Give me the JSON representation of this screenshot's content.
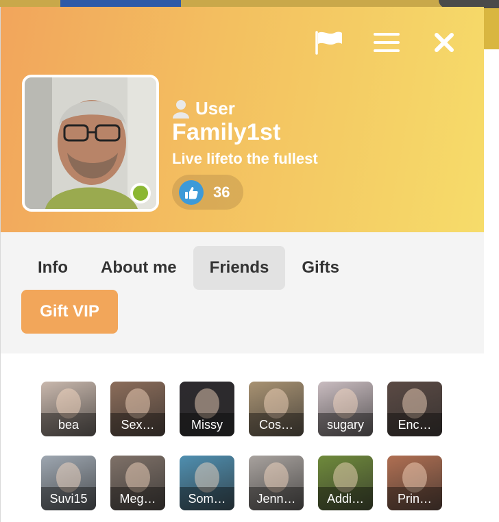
{
  "header": {
    "role": "User",
    "username": "Family1st",
    "tagline": "Live lifeto the fullest",
    "likes": "36",
    "icons": [
      "flag-icon",
      "menu-icon",
      "close-icon"
    ],
    "online": true
  },
  "tabs": [
    {
      "label": "Info",
      "active": false
    },
    {
      "label": "About me",
      "active": false
    },
    {
      "label": "Friends",
      "active": true
    },
    {
      "label": "Gifts",
      "active": false
    }
  ],
  "gift_vip_label": "Gift VIP",
  "friends": [
    {
      "name": "bea",
      "color": "#c9b8ad"
    },
    {
      "name": "Sex…",
      "color": "#8c6d5a"
    },
    {
      "name": "Missy",
      "color": "#2d2a2e"
    },
    {
      "name": "Cos…",
      "color": "#a89272"
    },
    {
      "name": "sugary",
      "color": "#c9bcc0"
    },
    {
      "name": "Enc…",
      "color": "#5b4a44"
    },
    {
      "name": "Suvi15",
      "color": "#9ea7b1"
    },
    {
      "name": "Meg…",
      "color": "#7f7168"
    },
    {
      "name": "Som…",
      "color": "#4f8fb0"
    },
    {
      "name": "Jenn…",
      "color": "#a8a29e"
    },
    {
      "name": "Addi…",
      "color": "#6f8a3b"
    },
    {
      "name": "Prin…",
      "color": "#b06f52"
    }
  ],
  "colors": {
    "header_start": "#f2a55c",
    "header_end": "#f6dc6a",
    "accent": "#f2a65a",
    "online": "#8bb733",
    "like_badge": "#3d9ad8"
  }
}
